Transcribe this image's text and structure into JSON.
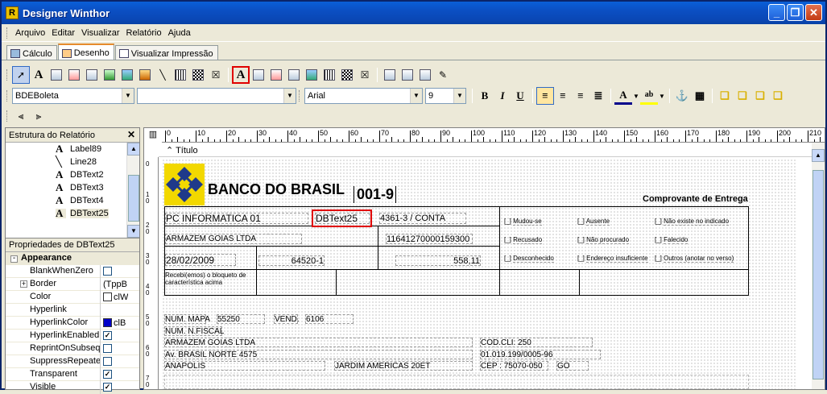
{
  "window": {
    "title": "Designer Winthor",
    "app_icon": "R"
  },
  "menu": [
    "Arquivo",
    "Editar",
    "Visualizar",
    "Relatório",
    "Ajuda"
  ],
  "tabs": [
    {
      "label": "Cálculo",
      "icon": "calc-icon"
    },
    {
      "label": "Desenho",
      "icon": "draw-icon",
      "active": true
    },
    {
      "label": "Visualizar Impressão",
      "icon": "page-icon"
    }
  ],
  "format_bar": {
    "dataset": "BDEBoleta",
    "field": "",
    "font": "Arial",
    "size": "9",
    "bold": "B",
    "italic": "I",
    "underline": "U",
    "font_color_glyph": "A"
  },
  "left_panel": {
    "tree_title": "Estrutura do Relatório",
    "tree_items": [
      {
        "label": "Label89",
        "icon": "label-icon"
      },
      {
        "label": "Line28",
        "icon": "line-icon"
      },
      {
        "label": "DBText2",
        "icon": "dbtext-icon"
      },
      {
        "label": "DBText3",
        "icon": "dbtext-icon"
      },
      {
        "label": "DBText4",
        "icon": "dbtext-icon"
      },
      {
        "label": "DBText25",
        "icon": "dbtext-icon",
        "selected": true
      }
    ],
    "props_title": "Propriedades de DBText25",
    "category": "Appearance",
    "props": [
      {
        "name": "BlankWhenZero",
        "type": "check",
        "checked": false
      },
      {
        "name": "Border",
        "type": "text",
        "value": "(TppB",
        "expand": "+"
      },
      {
        "name": "Color",
        "type": "color",
        "value": "clW",
        "color": "#FFFFFF"
      },
      {
        "name": "Hyperlink",
        "type": "text",
        "value": ""
      },
      {
        "name": "HyperlinkColor",
        "type": "color",
        "value": "clB",
        "color": "#0000C8"
      },
      {
        "name": "HyperlinkEnabled",
        "type": "check",
        "checked": true
      },
      {
        "name": "ReprintOnSubsequ",
        "type": "check",
        "checked": false
      },
      {
        "name": "SuppressRepeated",
        "type": "check",
        "checked": false
      },
      {
        "name": "Transparent",
        "type": "check",
        "checked": true
      },
      {
        "name": "Visible",
        "type": "check",
        "checked": true
      }
    ]
  },
  "ruler": {
    "h_labels": [
      "0",
      "10",
      "20",
      "30",
      "40",
      "50",
      "60",
      "70",
      "80",
      "90",
      "100",
      "110",
      "120",
      "130",
      "140",
      "150",
      "160",
      "170",
      "180",
      "190",
      "200",
      "210"
    ],
    "v_labels": [
      "0",
      "1\n0",
      "2\n0",
      "3\n0",
      "4\n0",
      "5\n0",
      "6\n0",
      "7\n0"
    ]
  },
  "band": {
    "label": "Título",
    "collapse_glyph": "⌃"
  },
  "report": {
    "bank_name": "BANCO DO BRASIL",
    "bank_code": "001-9",
    "receipt_title": "Comprovante de Entrega",
    "company": "PC INFORMATICA 01",
    "dbtext_selected": "DBText25",
    "agency": "4361-3 / CONTA",
    "client_name": "ARMAZEM GOIAS LTDA",
    "our_number": "11641270000159300",
    "date": "28/02/2009",
    "doc_number": "64520-1",
    "amount": "558,11",
    "receipt_note": "Recebi(emos) o bloqueto de característica acima",
    "reasons": [
      "Mudou-se",
      "Ausente",
      "Não existe no indicado",
      "Recusado",
      "Não procurado",
      "Falecido",
      "Desconhecido",
      "Endereço insuficiente",
      "Outros (anotar no verso)"
    ],
    "num_mapa_label": "NUM. MAPA",
    "num_mapa": "55250",
    "vend_label": "VEND.",
    "vend": "6106",
    "num_nfiscal_label": "NUM. N.FISCAL",
    "line_client": "ARMAZEM GOIAS LTDA",
    "cod_cli": "COD.CLI: 250",
    "address": "Av. BRASIL NORTE 4575",
    "cnpj": "01.019.199/0005-96",
    "city": "ANAPOLIS",
    "district": "JARDIM AMERICAS 20ET",
    "cep": "CEP : 75070-050",
    "state": "GO"
  }
}
